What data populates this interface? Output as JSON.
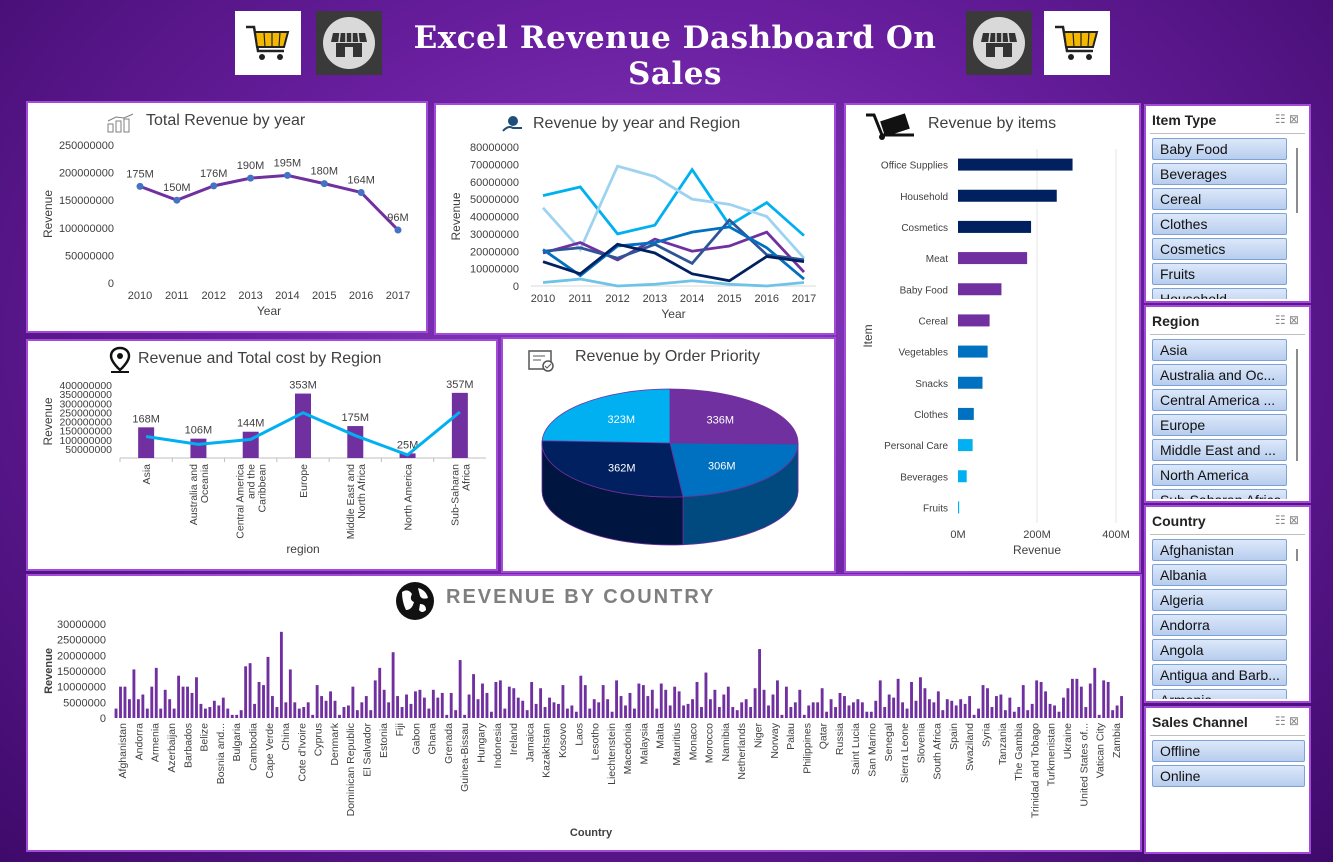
{
  "header": {
    "title": "Excel Revenue Dashboard On Sales"
  },
  "icons": {
    "cart": "shopping-cart-icon",
    "shop": "storefront-icon"
  },
  "colors": {
    "accent": "#7030a0",
    "navy": "#002060",
    "blue": "#0070c0",
    "light_blue": "#00b0f0"
  },
  "panels": {
    "year": {
      "title": "Total Revenue by year"
    },
    "year_region": {
      "title": "Revenue by year and Region"
    },
    "items": {
      "title": "Revenue by items"
    },
    "region": {
      "title": "Revenue and Total cost by Region"
    },
    "priority": {
      "title": "Revenue by Order Priority"
    },
    "country": {
      "title": "REVENUE BY COUNTRY"
    }
  },
  "slicers": {
    "item_type": {
      "title": "Item Type",
      "items": [
        "Baby Food",
        "Beverages",
        "Cereal",
        "Clothes",
        "Cosmetics",
        "Fruits",
        "Household"
      ]
    },
    "region": {
      "title": "Region",
      "items": [
        "Asia",
        "Australia and Oc...",
        "Central America ...",
        "Europe",
        "Middle East and ...",
        "North America",
        "Sub-Saharan Africa"
      ]
    },
    "country": {
      "title": "Country",
      "items": [
        "Afghanistan",
        "Albania",
        "Algeria",
        "Andorra",
        "Angola",
        "Antigua and Barb...",
        "Armenia"
      ]
    },
    "sales_channel": {
      "title": "Sales Channel",
      "items": [
        "Offline",
        "Online"
      ]
    }
  },
  "chart_data": [
    {
      "id": "year",
      "type": "line",
      "title": "Total Revenue by year",
      "xlabel": "Year",
      "ylabel": "Revenue",
      "x": [
        "2010",
        "2011",
        "2012",
        "2013",
        "2014",
        "2015",
        "2016",
        "2017"
      ],
      "values": [
        175000000,
        150000000,
        176000000,
        190000000,
        195000000,
        180000000,
        164000000,
        96000000
      ],
      "data_labels": [
        "175M",
        "150M",
        "176M",
        "190M",
        "195M",
        "180M",
        "164M",
        "96M"
      ],
      "ylim": [
        0,
        250000000
      ],
      "yticks": [
        "0",
        "50000000",
        "100000000",
        "150000000",
        "200000000",
        "250000000"
      ]
    },
    {
      "id": "year_region",
      "type": "line",
      "title": "Revenue by year and Region",
      "xlabel": "Year",
      "ylabel": "Revenue",
      "x": [
        "2010",
        "2011",
        "2012",
        "2013",
        "2014",
        "2015",
        "2016",
        "2017"
      ],
      "ylim": [
        0,
        80000000
      ],
      "yticks": [
        "0",
        "10000000",
        "20000000",
        "30000000",
        "40000000",
        "50000000",
        "60000000",
        "70000000",
        "80000000"
      ],
      "series": [
        {
          "color": "#00b0f0",
          "values": [
            52000000,
            57000000,
            30000000,
            35000000,
            67000000,
            35000000,
            48000000,
            29000000
          ]
        },
        {
          "color": "#9dd3f0",
          "values": [
            45000000,
            21000000,
            69000000,
            63000000,
            50000000,
            47000000,
            40000000,
            16000000
          ]
        },
        {
          "color": "#7030a0",
          "values": [
            19000000,
            25000000,
            15000000,
            27000000,
            20000000,
            23000000,
            31000000,
            8000000
          ]
        },
        {
          "color": "#2f5597",
          "values": [
            20000000,
            22000000,
            16000000,
            24000000,
            13000000,
            38000000,
            18000000,
            15000000
          ]
        },
        {
          "color": "#0070c0",
          "values": [
            21000000,
            6000000,
            23000000,
            25000000,
            31000000,
            34000000,
            22000000,
            4000000
          ]
        },
        {
          "color": "#002060",
          "values": [
            14000000,
            7000000,
            24000000,
            19000000,
            7000000,
            3000000,
            17000000,
            14000000
          ]
        },
        {
          "color": "#6fc3e8",
          "values": [
            2000000,
            4000000,
            0,
            1000000,
            3000000,
            1000000,
            0,
            2000000
          ]
        }
      ]
    },
    {
      "id": "items",
      "type": "bar",
      "title": "Revenue by items",
      "xlabel": "Revenue",
      "ylabel": "Item",
      "categories": [
        "Office Supplies",
        "Household",
        "Cosmetics",
        "Meat",
        "Baby Food",
        "Cereal",
        "Vegetables",
        "Snacks",
        "Clothes",
        "Personal Care",
        "Beverages",
        "Fruits"
      ],
      "values": [
        290000000,
        250000000,
        185000000,
        175000000,
        110000000,
        80000000,
        75000000,
        62000000,
        40000000,
        37000000,
        22000000,
        3000000
      ],
      "bar_colors": [
        "#002060",
        "#002060",
        "#002060",
        "#7030a0",
        "#7030a0",
        "#7030a0",
        "#0070c0",
        "#0070c0",
        "#0070c0",
        "#00b0f0",
        "#00b0f0",
        "#00b0f0"
      ],
      "xlim": [
        0,
        400000000
      ],
      "xticks": [
        "0M",
        "200M",
        "400M"
      ]
    },
    {
      "id": "region",
      "type": "bar",
      "title": "Revenue and Total cost by Region",
      "xlabel": "region",
      "ylabel": "Revenue",
      "categories": [
        "Asia",
        "Australia and Oceania",
        "Central America and the Caribbean",
        "Europe",
        "Middle East and North Africa",
        "North America",
        "Sub-Saharan Africa"
      ],
      "category_lines": [
        [
          "Asia"
        ],
        [
          "Australia and",
          "Oceania"
        ],
        [
          "Central America",
          "and the",
          "Caribbean"
        ],
        [
          "Europe"
        ],
        [
          "Middle East and",
          "North Africa"
        ],
        [
          "North America"
        ],
        [
          "Sub-Saharan",
          "Africa"
        ]
      ],
      "values": [
        168000000,
        106000000,
        144000000,
        353000000,
        175000000,
        25000000,
        357000000
      ],
      "data_labels": [
        "168M",
        "106M",
        "144M",
        "353M",
        "175M",
        "25M",
        "357M"
      ],
      "line_values": [
        118000000,
        75000000,
        102000000,
        248000000,
        123000000,
        17000000,
        252000000
      ],
      "ylim": [
        0,
        400000000
      ],
      "yticks": [
        "50000000",
        "100000000",
        "150000000",
        "200000000",
        "250000000",
        "300000000",
        "350000000",
        "400000000"
      ]
    },
    {
      "id": "priority",
      "type": "pie",
      "title": "Revenue by Order Priority",
      "values": [
        336000000,
        306000000,
        362000000,
        323000000
      ],
      "data_labels": [
        "336M",
        "306M",
        "362M",
        "323M"
      ],
      "colors": [
        "#7030a0",
        "#0070c0",
        "#002060",
        "#00b0f0"
      ]
    },
    {
      "id": "country",
      "type": "bar",
      "title": "REVENUE BY COUNTRY",
      "xlabel": "Country",
      "ylabel": "Revenue",
      "ylim": [
        0,
        30000000
      ],
      "yticks": [
        "0",
        "5000000",
        "10000000",
        "15000000",
        "20000000",
        "25000000",
        "30000000"
      ],
      "tick_labels": [
        "Afghanistan",
        "Andorra",
        "Armenia",
        "Azerbaijan",
        "Barbados",
        "Belize",
        "Bosnia and...",
        "Bulgaria",
        "Cambodia",
        "Cape Verde",
        "China",
        "Cote d'Ivoire",
        "Cyprus",
        "Denmark",
        "Dominican Republic",
        "El Salvador",
        "Estonia",
        "Fiji",
        "Gabon",
        "Ghana",
        "Grenada",
        "Guinea-Bissau",
        "Hungary",
        "Indonesia",
        "Ireland",
        "Jamaica",
        "Kazakhstan",
        "Kosovo",
        "Laos",
        "Lesotho",
        "Liechtenstein",
        "Macedonia",
        "Malaysia",
        "Malta",
        "Mauritius",
        "Monaco",
        "Morocco",
        "Namibia",
        "Netherlands",
        "Niger",
        "Norway",
        "Palau",
        "Philippines",
        "Qatar",
        "Russia",
        "Saint Lucia",
        "San Marino",
        "Senegal",
        "Sierra Leone",
        "Slovenia",
        "South Africa",
        "Spain",
        "Swaziland",
        "Syria",
        "Tanzania",
        "The Gambia",
        "Trinidad and Tobago",
        "Turkmenistan",
        "Ukraine",
        "United States of...",
        "Vatican City",
        "Zambia"
      ],
      "values": [
        3000000,
        10000000,
        10000000,
        6000000,
        15500000,
        6000000,
        7500000,
        3000000,
        10000000,
        16000000,
        3000000,
        9000000,
        6000000,
        3000000,
        13500000,
        10000000,
        10000000,
        8000000,
        13000000,
        4500000,
        3000000,
        3500000,
        5500000,
        4000000,
        6500000,
        3000000,
        1000000,
        1000000,
        2500000,
        16500000,
        17500000,
        4500000,
        11500000,
        10500000,
        19500000,
        7000000,
        3500000,
        27500000,
        5000000,
        15500000,
        5000000,
        3000000,
        3500000,
        5000000,
        1000000,
        10500000,
        7000000,
        5500000,
        8500000,
        5500000,
        1000000,
        3500000,
        4000000,
        10000000,
        2500000,
        5000000,
        7000000,
        2500000,
        12000000,
        16000000,
        9000000,
        5000000,
        21000000,
        7000000,
        3500000,
        7500000,
        4500000,
        8500000,
        9000000,
        6500000,
        3000000,
        9000000,
        6500000,
        8000000,
        1000000,
        8000000,
        2500000,
        18500000,
        1000000,
        7500000,
        14000000,
        6000000,
        11000000,
        8000000,
        2000000,
        11500000,
        12000000,
        3000000,
        10000000,
        9500000,
        6500000,
        5500000,
        2500000,
        11500000,
        4500000,
        9500000,
        3500000,
        6500000,
        5000000,
        4500000,
        10500000,
        3000000,
        4000000,
        2000000,
        13500000,
        10500000,
        3000000,
        6000000,
        5000000,
        10500000,
        6000000,
        2000000,
        12000000,
        7000000,
        4000000,
        8000000,
        3000000,
        11000000,
        10500000,
        7000000,
        9000000,
        3000000,
        11000000,
        9000000,
        4000000,
        10000000,
        8500000,
        4000000,
        4500000,
        6000000,
        11500000,
        3500000,
        14500000,
        6000000,
        9000000,
        3500000,
        7500000,
        10000000,
        3500000,
        2500000,
        5000000,
        6000000,
        3500000,
        9500000,
        22000000,
        9000000,
        4000000,
        7500000,
        12000000,
        1000000,
        10000000,
        3500000,
        5000000,
        9000000,
        1000000,
        4000000,
        5000000,
        5000000,
        9500000,
        2000000,
        6000000,
        3500000,
        8000000,
        7000000,
        4000000,
        5000000,
        6000000,
        5000000,
        2000000,
        2000000,
        5500000,
        12000000,
        3500000,
        7500000,
        6500000,
        12500000,
        5000000,
        3000000,
        11500000,
        5500000,
        13000000,
        9500000,
        6000000,
        5000000,
        8500000,
        2500000,
        6000000,
        5500000,
        4000000,
        6000000,
        4500000,
        7000000,
        1000000,
        3000000,
        10500000,
        9500000,
        3500000,
        7000000,
        7500000,
        2500000,
        6500000,
        2000000,
        3500000,
        10500000,
        2500000,
        4500000,
        12000000,
        11500000,
        8500000,
        4500000,
        4000000,
        2000000,
        6500000,
        9500000,
        12500000,
        12500000,
        10000000,
        3500000,
        11000000,
        16000000,
        1000000,
        12000000,
        11500000,
        2500000,
        4000000,
        7000000
      ]
    }
  ]
}
